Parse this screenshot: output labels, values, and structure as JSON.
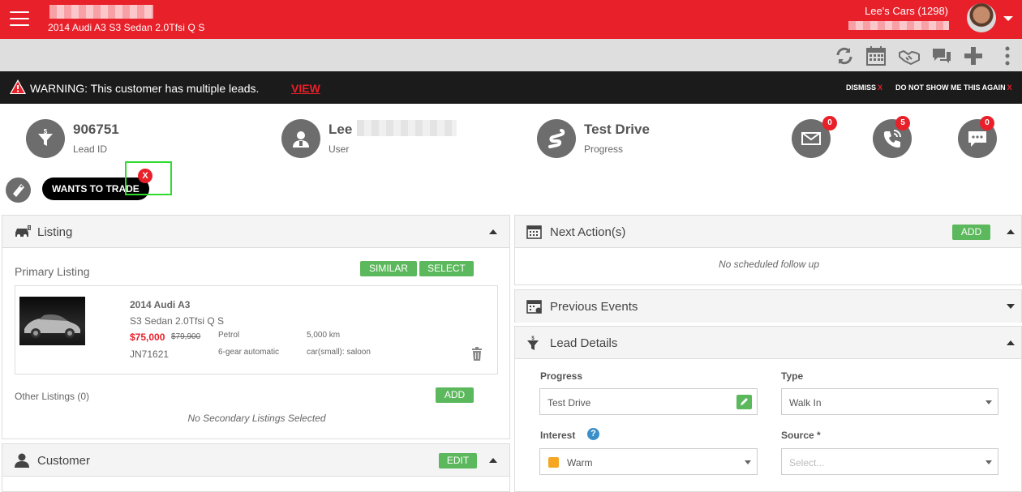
{
  "header": {
    "vehicle_title": "2014 Audi A3 S3 Sedan 2.0Tfsi Q S",
    "dealer": "Lee's Cars (1298)"
  },
  "toolbar": {
    "icons": [
      "refresh-icon",
      "calendar-icon",
      "handshake-icon",
      "chat-icon",
      "plus-icon",
      "more-icon"
    ]
  },
  "warning": {
    "message": "WARNING: This customer has multiple leads.",
    "view": "VIEW",
    "dismiss": "DISMISS",
    "dismiss_x": "X",
    "no_show": "DO NOT SHOW ME THIS AGAIN",
    "no_show_x": "X"
  },
  "summary": {
    "lead_id": "906751",
    "lead_id_label": "Lead ID",
    "user": "Lee",
    "user_label": "User",
    "progress": "Test Drive",
    "progress_label": "Progress",
    "email_count": "0",
    "call_count": "5",
    "sms_count": "0"
  },
  "tag": {
    "label": "WANTS TO TRADE",
    "remove": "X"
  },
  "listing": {
    "title": "Listing",
    "primary_label": "Primary Listing",
    "similar_btn": "SIMILAR",
    "select_btn": "SELECT",
    "car_title": "2014 Audi A3",
    "car_subtitle": "S3 Sedan 2.0Tfsi Q S",
    "price": "$75,000",
    "old_price": "$79,900",
    "stock": "JN71621",
    "fuel": "Petrol",
    "transmission": "6-gear automatic",
    "odometer": "5,000 km",
    "body": "car(small): saloon",
    "other_label": "Other Listings (0)",
    "add_btn": "ADD",
    "empty": "No Secondary Listings Selected"
  },
  "customer": {
    "title": "Customer",
    "edit_btn": "EDIT"
  },
  "next_actions": {
    "title": "Next Action(s)",
    "add_btn": "ADD",
    "empty": "No scheduled follow up"
  },
  "previous_events": {
    "title": "Previous Events"
  },
  "lead_details": {
    "title": "Lead Details",
    "progress_label": "Progress",
    "progress_value": "Test Drive",
    "type_label": "Type",
    "type_value": "Walk In",
    "interest_label": "Interest",
    "interest_value": "Warm",
    "interest_color": "#f5a623",
    "source_label": "Source *",
    "source_placeholder": "Select..."
  },
  "colors": {
    "brand": "#e8202a",
    "success": "#5cb85c",
    "dark_bar": "#1b1b1b"
  }
}
